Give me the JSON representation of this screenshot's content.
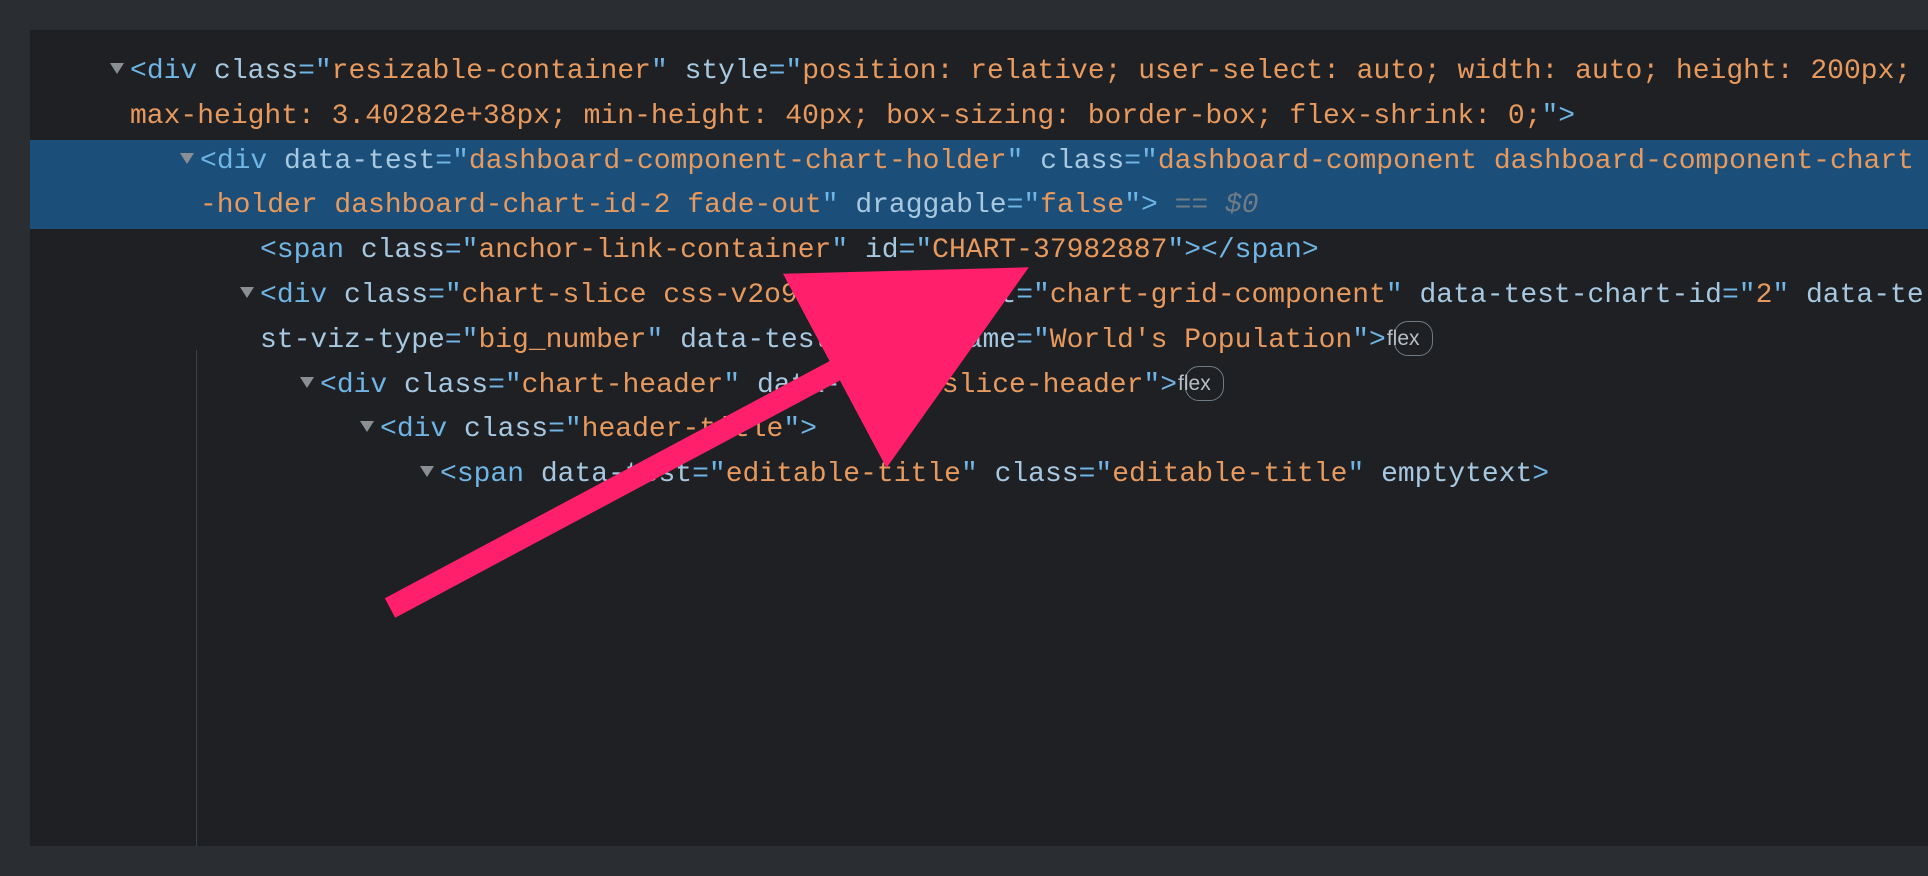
{
  "badges": {
    "flex": "flex"
  },
  "console_ref": " == $0",
  "nodes": {
    "n0": {
      "tag": "div",
      "attrs": {
        "class": "resizable-container",
        "style": "position: relative; user-select: auto; width: auto; height: 200px; max-height: 3.40282e+38px; min-height: 40px; box-sizing: border-box; flex-shrink: 0;"
      }
    },
    "n1": {
      "tag": "div",
      "attrs": {
        "data-test": "dashboard-component-chart-holder",
        "class": "dashboard-component dashboard-component-chart-holder dashboard-chart-id-2 fade-out",
        "draggable": "false"
      }
    },
    "n2": {
      "tag": "span",
      "attrs": {
        "class": "anchor-link-container",
        "id": "CHART-37982887"
      }
    },
    "n3": {
      "tag": "div",
      "attrs": {
        "class": "chart-slice css-v2o9ep",
        "data-test": "chart-grid-component",
        "data-test-chart-id": "2",
        "data-test-viz-type": "big_number",
        "data-test-chart-name": "World's Population"
      }
    },
    "n4": {
      "tag": "div",
      "attrs": {
        "class": "chart-header",
        "data-test": "slice-header"
      }
    },
    "n5": {
      "tag": "div",
      "attrs": {
        "class": "header-title"
      }
    },
    "n6": {
      "tag": "span",
      "attrs": {
        "data-test": "editable-title",
        "class": "editable-title",
        "emptytext": ""
      },
      "trailing_attr_only": "emptytext"
    }
  }
}
